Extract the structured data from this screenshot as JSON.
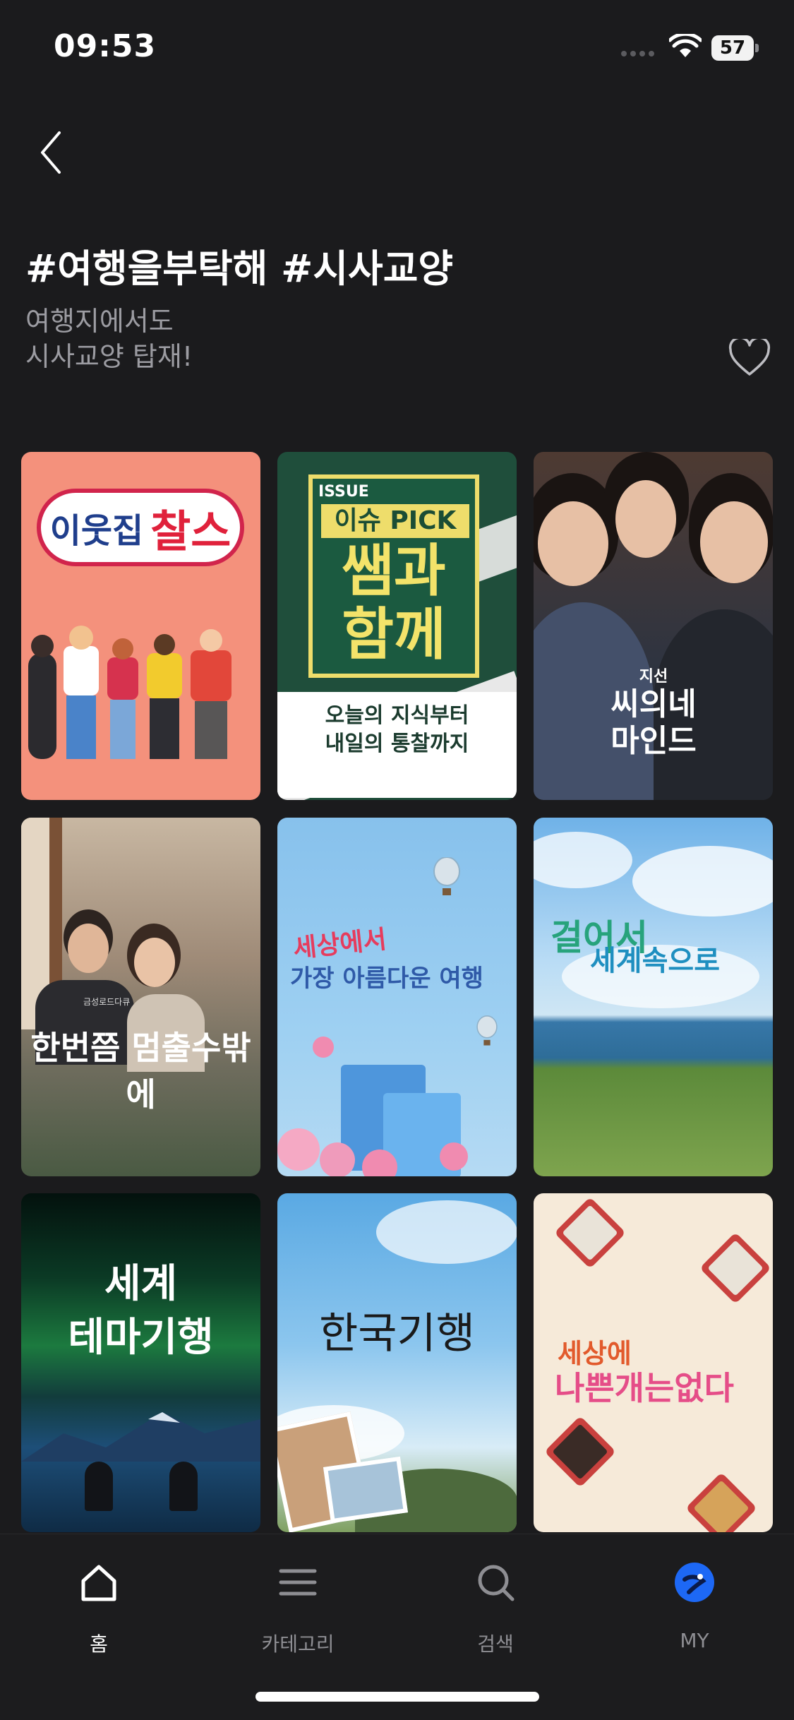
{
  "status_bar": {
    "time": "09:53",
    "battery": "57"
  },
  "header": {
    "title": "#여행을부탁해 #시사교양",
    "subtitle_line1": "여행지에서도",
    "subtitle_line2": "시사교양 탑재!"
  },
  "posters": [
    {
      "title_a": "이웃집",
      "title_b": "찰스"
    },
    {
      "badge": "ISSUE",
      "pick": "이슈 PICK",
      "big1": "쌤과",
      "big2": "함께",
      "sub1": "오늘의 지식부터",
      "sub2": "내일의 통찰까지"
    },
    {
      "top": "지선",
      "line1": "씨의네",
      "line2": "마인드"
    },
    {
      "channel": "금성로드다큐",
      "title": "한번쯤 멈출수밖에"
    },
    {
      "line1": "세상에서",
      "line2": "가장 아름다운 여행"
    },
    {
      "line1": "걸어서",
      "line2": "세계속으로"
    },
    {
      "line1": "세계",
      "line2": "테마기행"
    },
    {
      "title": "한국기행"
    },
    {
      "line1": "세상에",
      "line2": "나쁜개는없다"
    }
  ],
  "tabs": [
    {
      "label": "홈",
      "icon": "home-icon"
    },
    {
      "label": "카테고리",
      "icon": "menu-icon"
    },
    {
      "label": "검색",
      "icon": "search-icon"
    },
    {
      "label": "MY",
      "icon": "profile-icon"
    }
  ],
  "colors": {
    "background": "#1b1b1d",
    "tab_bar": "#1c1c1e",
    "text_muted": "#9c9ca2",
    "my_accent": "#1d68f5"
  }
}
